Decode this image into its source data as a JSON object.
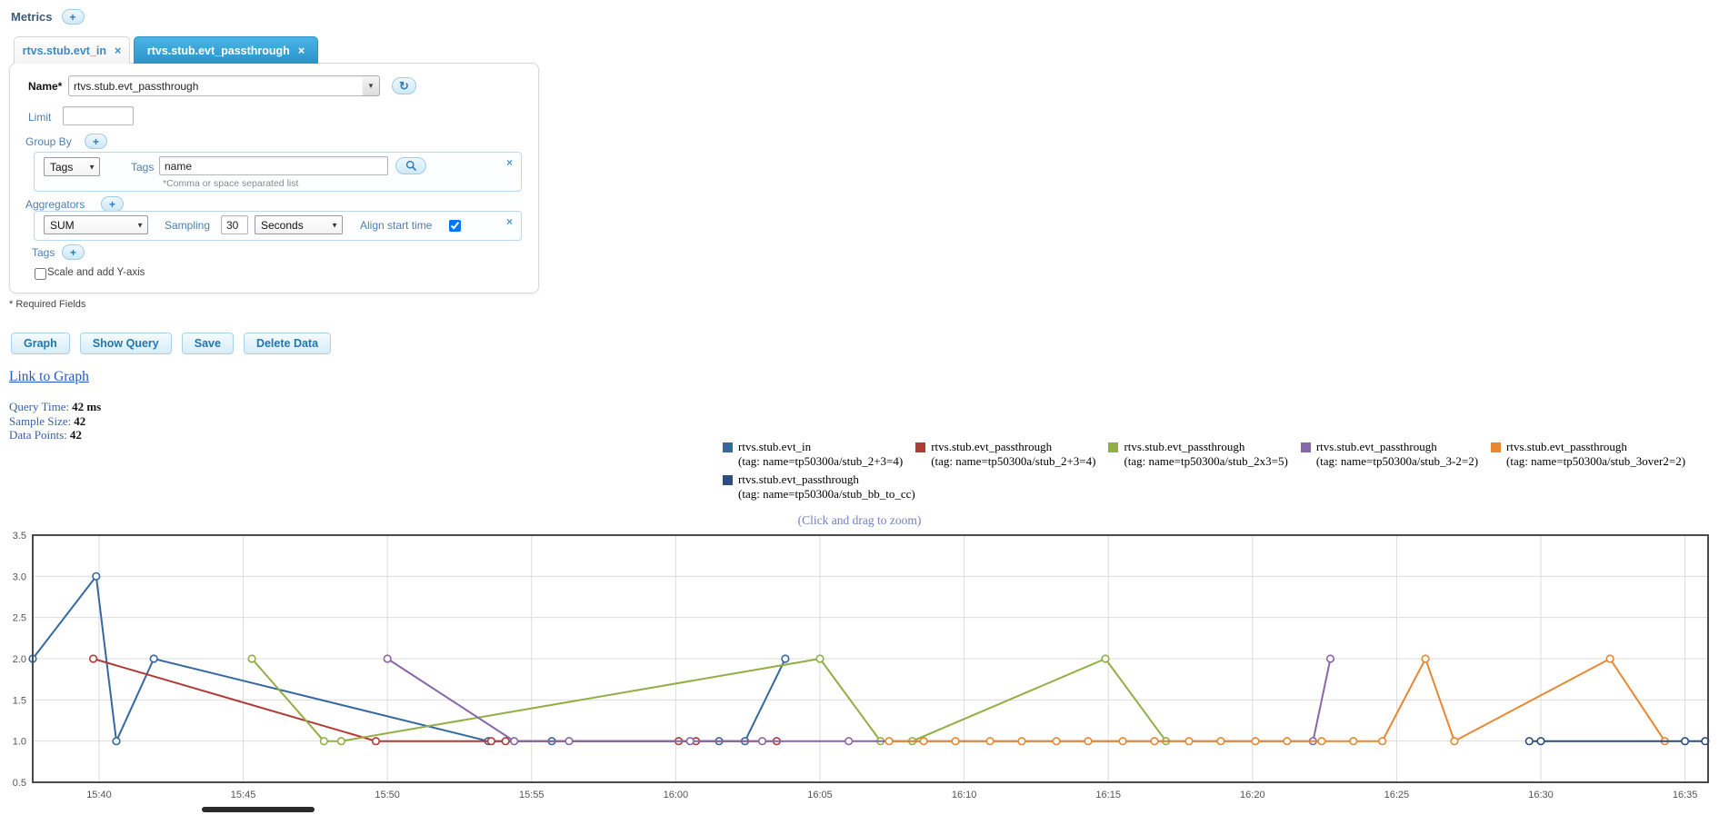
{
  "icons": {
    "add": "+",
    "close": "×",
    "caret": "▼",
    "refresh": "↻"
  },
  "colors": {
    "tab_active": "#38a3d8",
    "accent_blue": "#2e7cb8",
    "link": "#2457c5"
  },
  "metrics_header": {
    "label": "Metrics"
  },
  "tabs": [
    {
      "label": "rtvs.stub.evt_in",
      "active": false
    },
    {
      "label": "rtvs.stub.evt_passthrough",
      "active": true
    }
  ],
  "form": {
    "name_label": "Name*",
    "name_value": "rtvs.stub.evt_passthrough",
    "limit_label": "Limit",
    "limit_value": "",
    "group_by": {
      "label": "Group By",
      "type_select": "Tags",
      "tags_label": "Tags",
      "tags_value": "name",
      "help": "*Comma or space separated list"
    },
    "aggregators": {
      "label": "Aggregators",
      "selected": "SUM",
      "sampling_label": "Sampling",
      "sampling_value": "30",
      "unit_select": "Seconds",
      "align_label": "Align start time",
      "align_checked": true
    },
    "tags_section": {
      "label": "Tags"
    },
    "scale_label": "Scale and add Y-axis",
    "scale_checked": false,
    "required_note": "* Required Fields"
  },
  "actions": {
    "graph": "Graph",
    "show_query": "Show Query",
    "save": "Save",
    "delete_data": "Delete Data"
  },
  "link_to_graph": "Link to Graph",
  "stats": [
    {
      "label": "Query Time:",
      "value": "42 ms"
    },
    {
      "label": "Sample Size:",
      "value": "42"
    },
    {
      "label": "Data Points:",
      "value": "42"
    }
  ],
  "zoom_hint": "(Click and drag to zoom)",
  "chart_data": {
    "type": "line",
    "x_encoding": "minutes after 15:00",
    "xlim": [
      37.7,
      95.8
    ],
    "ylim": [
      0.5,
      3.5
    ],
    "grid": true,
    "x_ticks": [
      {
        "m": 40,
        "label": "15:40"
      },
      {
        "m": 45,
        "label": "15:45"
      },
      {
        "m": 50,
        "label": "15:50"
      },
      {
        "m": 55,
        "label": "15:55"
      },
      {
        "m": 60,
        "label": "16:00"
      },
      {
        "m": 65,
        "label": "16:05"
      },
      {
        "m": 70,
        "label": "16:10"
      },
      {
        "m": 75,
        "label": "16:15"
      },
      {
        "m": 80,
        "label": "16:20"
      },
      {
        "m": 85,
        "label": "16:25"
      },
      {
        "m": 90,
        "label": "16:30"
      },
      {
        "m": 95,
        "label": "16:35"
      }
    ],
    "y_ticks": [
      0.5,
      1.0,
      1.5,
      2.0,
      2.5,
      3.0,
      3.5
    ],
    "series": [
      {
        "name": "rtvs.stub.evt_in",
        "tag": "name=tp50300a/stub_2+3=4",
        "color": "#35689f",
        "points": [
          [
            37.7,
            2
          ],
          [
            39.9,
            3
          ],
          [
            40.6,
            1
          ],
          [
            41.9,
            2
          ],
          [
            53.5,
            1
          ],
          [
            55.7,
            1
          ],
          [
            61.5,
            1
          ],
          [
            62.4,
            1
          ],
          [
            63.8,
            2
          ]
        ]
      },
      {
        "name": "rtvs.stub.evt_passthrough",
        "tag": "name=tp50300a/stub_2+3=4",
        "color": "#b03a34",
        "points": [
          [
            39.8,
            2
          ],
          [
            49.6,
            1
          ],
          [
            53.6,
            1
          ],
          [
            54.1,
            1
          ],
          [
            60.1,
            1
          ],
          [
            60.7,
            1
          ],
          [
            63.5,
            1
          ]
        ]
      },
      {
        "name": "rtvs.stub.evt_passthrough",
        "tag": "name=tp50300a/stub_2x3=5",
        "color": "#92af45",
        "points": [
          [
            45.3,
            2
          ],
          [
            47.8,
            1
          ],
          [
            48.4,
            1
          ],
          [
            65,
            2
          ],
          [
            67.1,
            1
          ],
          [
            68.2,
            1
          ],
          [
            74.9,
            2
          ],
          [
            77,
            1
          ]
        ]
      },
      {
        "name": "rtvs.stub.evt_passthrough",
        "tag": "name=tp50300a/stub_3-2=2",
        "color": "#8767a9",
        "points": [
          [
            50,
            2
          ],
          [
            54.4,
            1
          ],
          [
            56.3,
            1
          ],
          [
            60.5,
            1
          ],
          [
            63,
            1
          ],
          [
            66,
            1
          ],
          [
            82.1,
            1
          ],
          [
            82.7,
            2
          ]
        ]
      },
      {
        "name": "rtvs.stub.evt_passthrough",
        "tag": "name=tp50300a/stub_3over2=2",
        "color": "#e8872f",
        "points": [
          [
            67.4,
            1
          ],
          [
            68.6,
            1
          ],
          [
            69.7,
            1
          ],
          [
            70.9,
            1
          ],
          [
            72,
            1
          ],
          [
            73.2,
            1
          ],
          [
            74.3,
            1
          ],
          [
            75.5,
            1
          ],
          [
            76.6,
            1
          ],
          [
            77.8,
            1
          ],
          [
            78.9,
            1
          ],
          [
            80.1,
            1
          ],
          [
            81.2,
            1
          ],
          [
            82.4,
            1
          ],
          [
            83.5,
            1
          ],
          [
            84.5,
            1
          ],
          [
            86,
            2
          ],
          [
            87,
            1
          ],
          [
            92.4,
            2
          ],
          [
            94.3,
            1
          ]
        ]
      },
      {
        "name": "rtvs.stub.evt_passthrough",
        "tag": "name=tp50300a/stub_bb_to_cc",
        "color": "#2c4d7e",
        "points": [
          [
            89.6,
            1
          ],
          [
            90,
            1
          ],
          [
            95,
            1
          ],
          [
            95.7,
            1
          ]
        ]
      }
    ]
  }
}
